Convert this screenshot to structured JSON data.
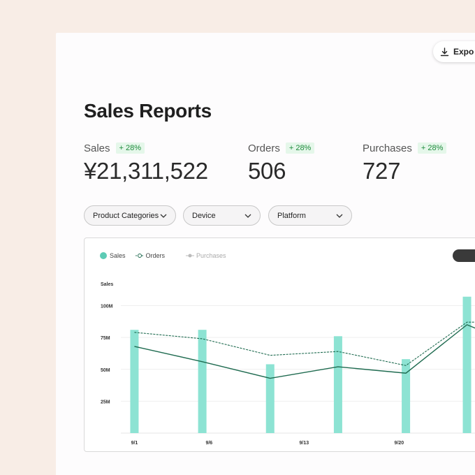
{
  "header": {
    "export_label": "Expo",
    "title": "Sales Reports"
  },
  "kpis": [
    {
      "label": "Sales",
      "badge": "+ 28%",
      "value": "¥21,311,522"
    },
    {
      "label": "Orders",
      "badge": "+ 28%",
      "value": "506"
    },
    {
      "label": "Purchases",
      "badge": "+ 28%",
      "value": "727"
    }
  ],
  "filters": [
    {
      "label": "Product Categories"
    },
    {
      "label": "Device"
    },
    {
      "label": "Platform"
    }
  ],
  "legend": {
    "sales": "Sales",
    "orders": "Orders",
    "purchases": "Purchases"
  },
  "colors": {
    "bar": "#8de3d3",
    "sales_line": "#1f6b50",
    "orders_line": "#1f6b50",
    "badge_text": "#1d8a3b",
    "badge_bg": "#e5f7ea"
  },
  "chart_data": {
    "type": "bar",
    "ylabel": "Sales",
    "ylim": [
      0,
      120
    ],
    "y_ticks": [
      "25M",
      "50M",
      "75M",
      "100M"
    ],
    "y_tick_values": [
      25,
      50,
      75,
      100
    ],
    "x": [
      1,
      6,
      11,
      13,
      18,
      20,
      23
    ],
    "x_tick_labels": [
      "9/1",
      "9/6",
      "9/13",
      "9/20"
    ],
    "x_tick_values": [
      1,
      6.5,
      13.5,
      20.5
    ],
    "bar_x": [
      1,
      6,
      11,
      16,
      21
    ],
    "bars": [
      81,
      81,
      54,
      76,
      58,
      107
    ],
    "bar_positions": [
      1,
      6,
      11,
      16,
      21,
      25.5
    ],
    "series": [
      {
        "name": "Sales",
        "x": [
          1,
          6,
          11,
          16,
          21,
          25.5,
          28
        ],
        "values": [
          68,
          56,
          43,
          52,
          47,
          85,
          74
        ]
      },
      {
        "name": "Orders",
        "x": [
          1,
          6,
          11,
          16,
          21,
          25.5,
          28
        ],
        "values": [
          79,
          74,
          61,
          64,
          53,
          87,
          87
        ]
      }
    ],
    "grid": true
  }
}
